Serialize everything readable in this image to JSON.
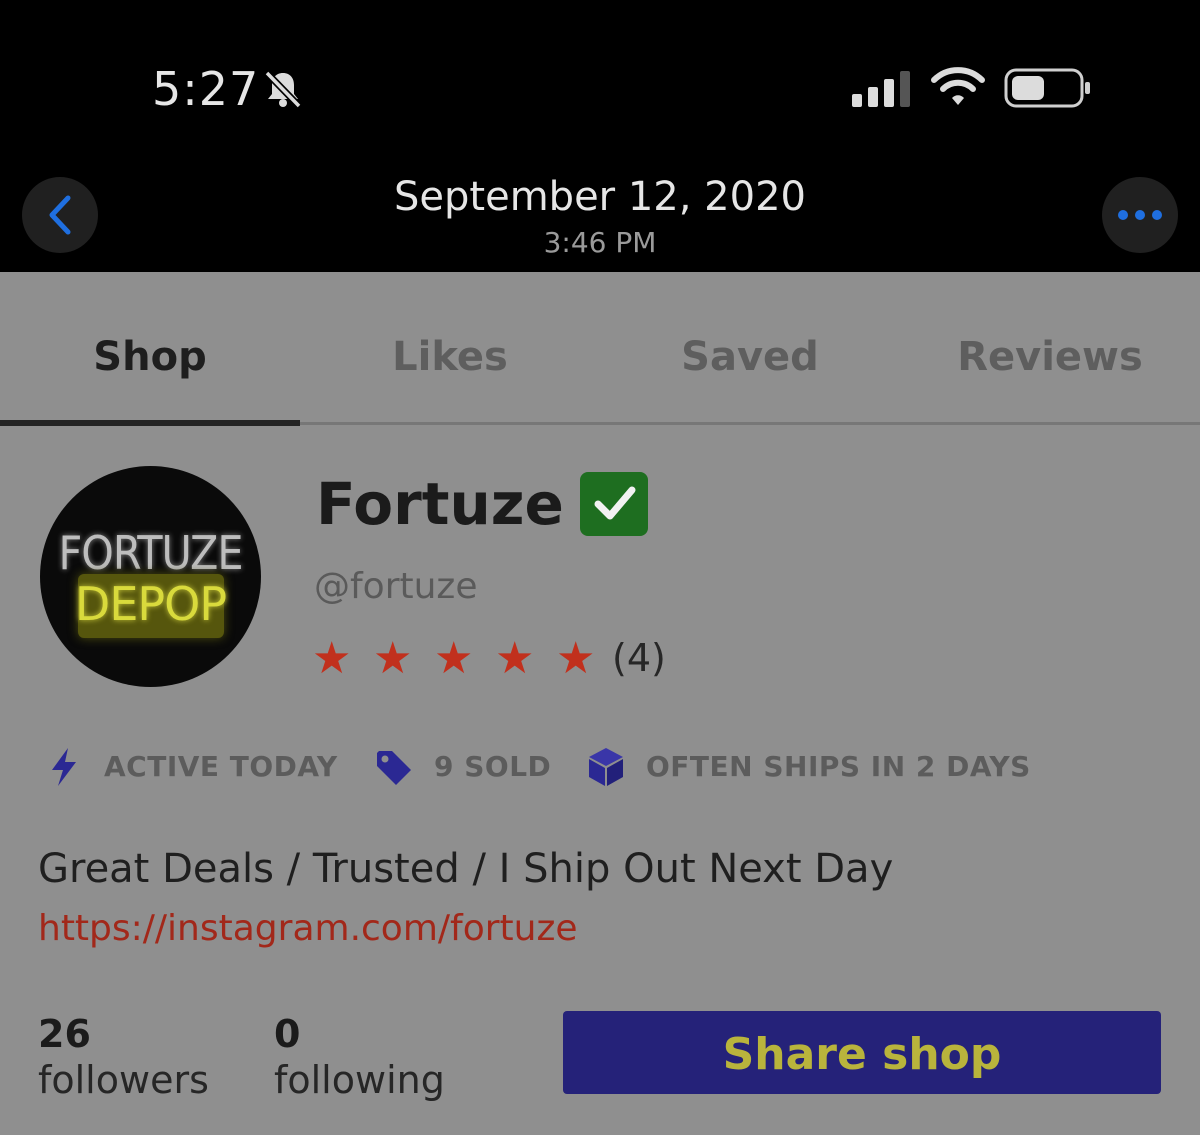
{
  "status_bar": {
    "time": "5:27",
    "icons": [
      "bell-slash-icon",
      "cellular-signal-icon",
      "wifi-icon",
      "battery-icon"
    ]
  },
  "header": {
    "date": "September 12, 2020",
    "time": "3:46 PM",
    "back_icon": "chevron-left-icon",
    "more_icon": "ellipsis-icon"
  },
  "tabs": [
    {
      "label": "Shop",
      "active": true
    },
    {
      "label": "Likes",
      "active": false
    },
    {
      "label": "Saved",
      "active": false
    },
    {
      "label": "Reviews",
      "active": false
    }
  ],
  "profile": {
    "avatar_text_top": "FORTUZE",
    "avatar_text_bottom": "DEPOP",
    "name": "Fortuze",
    "verified_icon": "check-mark-button-icon",
    "handle": "@fortuze",
    "rating_stars": 5,
    "review_count": "(4)",
    "star_color": "#c1301d"
  },
  "badges": [
    {
      "icon": "lightning-icon",
      "label": "ACTIVE TODAY"
    },
    {
      "icon": "tag-icon",
      "label": "9 SOLD"
    },
    {
      "icon": "box-icon",
      "label": "OFTEN SHIPS IN 2 DAYS"
    }
  ],
  "bio": {
    "text": "Great Deals / Trusted / I Ship Out Next Day",
    "link": "https://instagram.com/fortuze"
  },
  "stats": {
    "followers_count": "26",
    "followers_label": "followers",
    "following_count": "0",
    "following_label": "following"
  },
  "actions": {
    "share_label": "Share shop"
  },
  "colors": {
    "accent_blue": "#252279",
    "link_red": "#a2281a",
    "ios_blue": "#1f6fe0"
  }
}
